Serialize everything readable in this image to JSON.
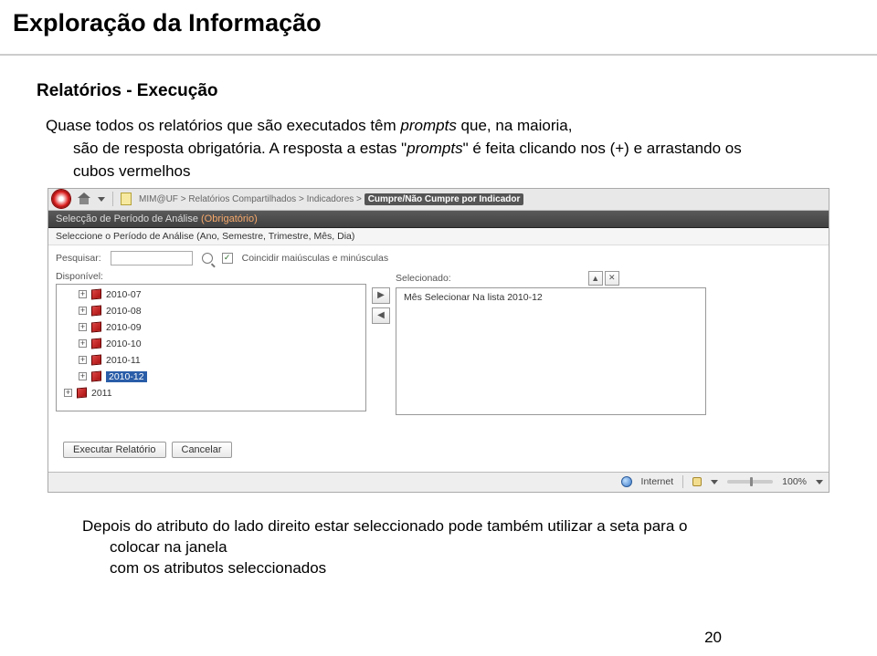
{
  "page": {
    "title": "Exploração da Informação",
    "subtitle": "Relatórios - Execução",
    "paragraph_l1": "Quase todos os relatórios que são executados têm ",
    "paragraph_ital1": "prompts",
    "paragraph_l2": " que, na maioria,",
    "paragraph_l3_a": "são de resposta obrigatória. A resposta a estas \"",
    "paragraph_ital2": "prompts",
    "paragraph_l3_b": "\" é feita clicando nos (+) e arrastando os",
    "paragraph_l4": "cubos vermelhos",
    "footer_l1": "Depois do atributo do lado direito estar seleccionado pode também utilizar a seta para o",
    "footer_l2": "colocar na janela",
    "footer_l3": "com os atributos seleccionados",
    "page_number": "20"
  },
  "app": {
    "breadcrumb": {
      "root": "MIM@UF",
      "p1": "Relatórios Compartilhados",
      "p2": "Indicadores",
      "current": "Cumpre/Não Cumpre por Indicador"
    },
    "prompt_title": "Selecção de Período de Análise",
    "prompt_req": "(Obrigatório)",
    "prompt_sub": "Seleccione o Período de Análise (Ano, Semestre, Trimestre, Mês, Dia)",
    "search_label": "Pesquisar:",
    "match_case": "Coincidir maiúsculas e minúsculas",
    "available_label": "Disponível:",
    "selected_label": "Selecionado:",
    "selected_item": "Mês Selecionar Na lista 2010-12",
    "tree": [
      "2010-07",
      "2010-08",
      "2010-09",
      "2010-10",
      "2010-11",
      "2010-12"
    ],
    "tree_year": "2011",
    "btn_exec": "Executar Relatório",
    "btn_cancel": "Cancelar",
    "status_internet": "Internet",
    "status_zoom": "100%"
  }
}
